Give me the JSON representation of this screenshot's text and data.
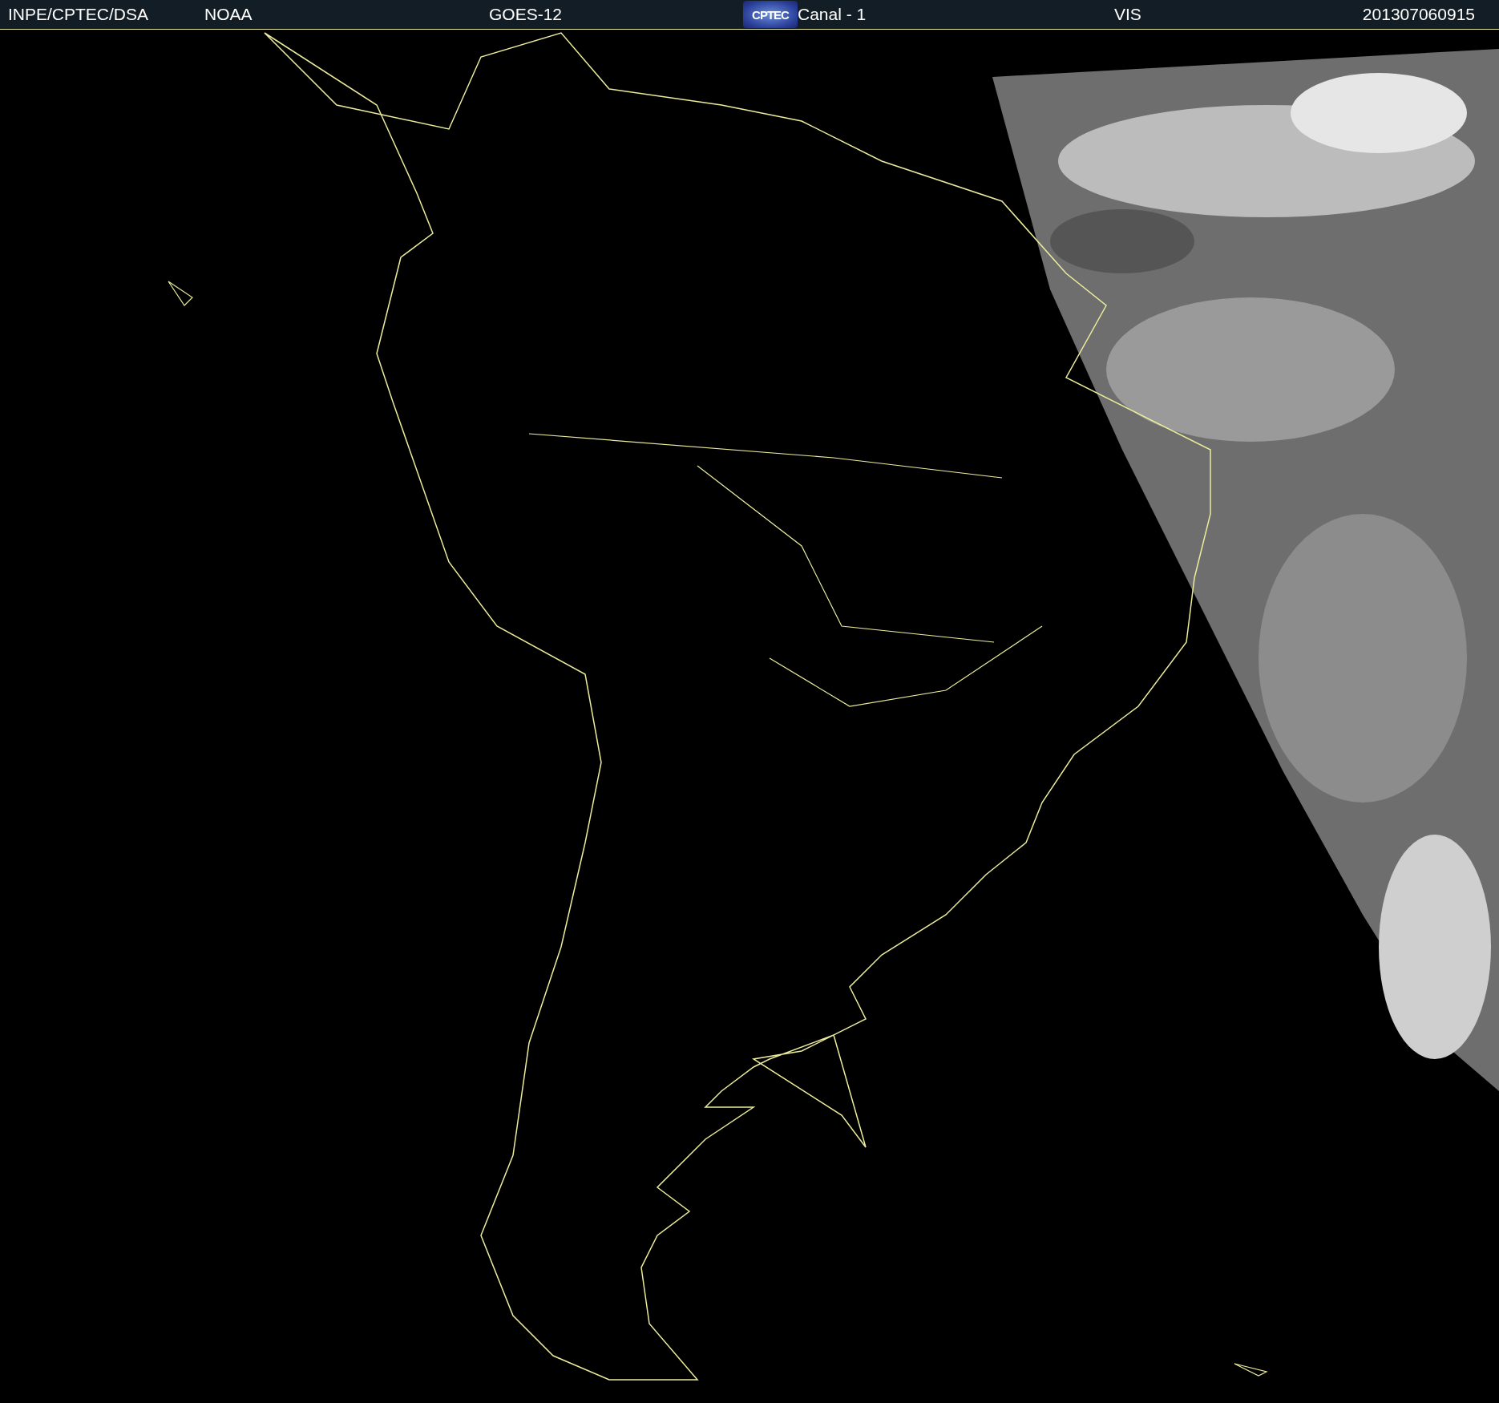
{
  "header": {
    "items": [
      {
        "kind": "text",
        "text": "INPE/CPTEC/DSA"
      },
      {
        "kind": "text",
        "text": "NOAA"
      },
      {
        "kind": "text",
        "text": "GOES-12"
      },
      {
        "kind": "logo",
        "text": "CPTEC"
      },
      {
        "kind": "text",
        "text": "Canal - 1"
      },
      {
        "kind": "text",
        "text": "VIS"
      },
      {
        "kind": "text",
        "text": "201307060915"
      }
    ]
  }
}
